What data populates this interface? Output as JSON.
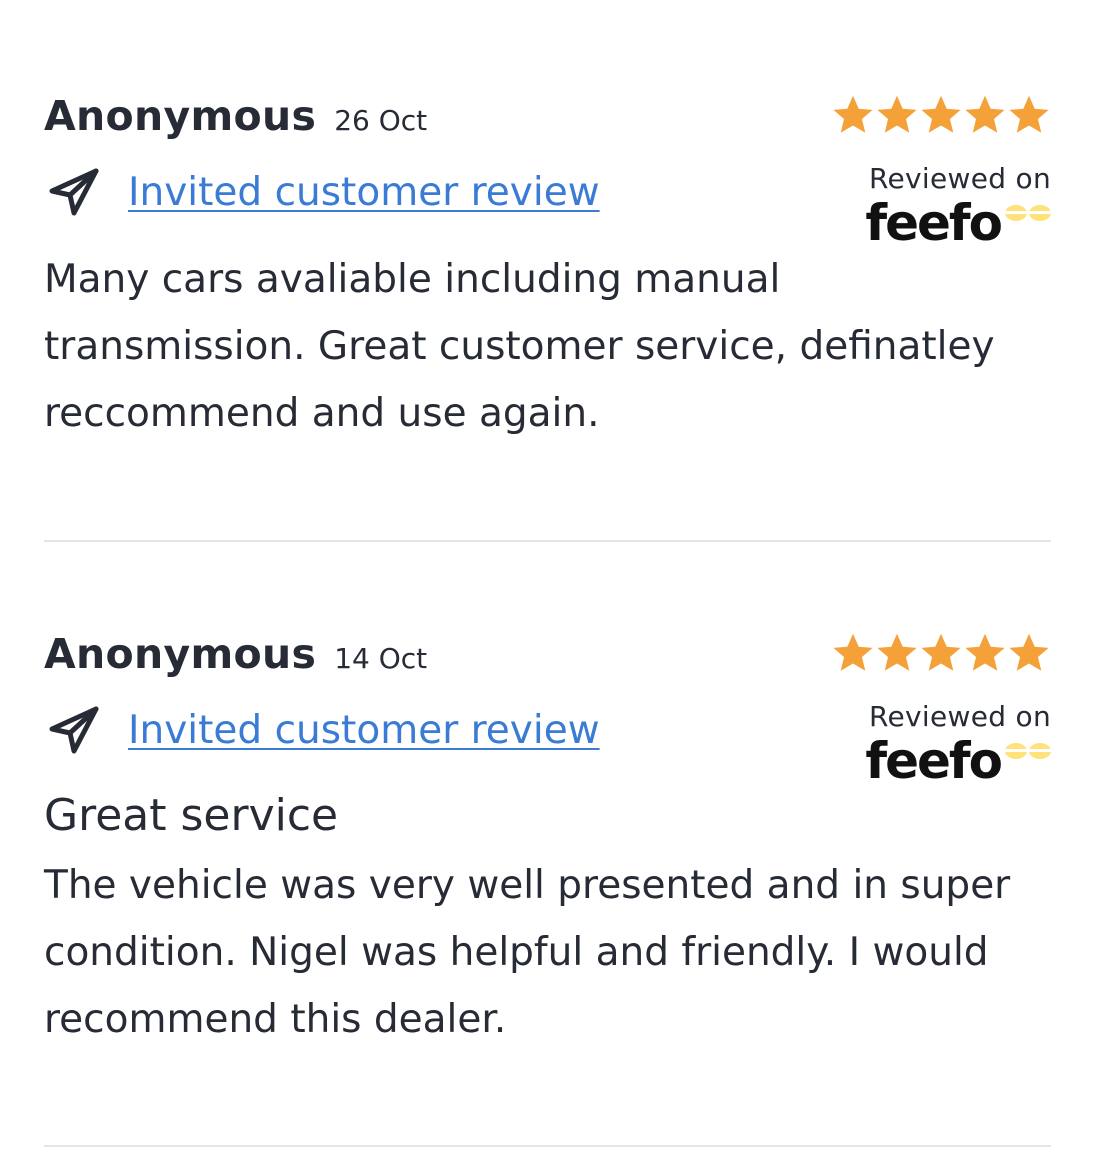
{
  "colors": {
    "text": "#272b36",
    "link": "#3a7bd5",
    "star": "#f5a13a",
    "divider": "#e4e5e7",
    "feefo_eyes": "#ffe27a"
  },
  "reviews": [
    {
      "author": "Anonymous",
      "date": "26 Oct",
      "invite_label": "Invited customer review",
      "invite_icon": "paper-plane-icon",
      "rating": 5,
      "rating_max": 5,
      "reviewed_on": "Reviewed on",
      "platform_logo_text": "feefo",
      "title": "",
      "body": "Many cars avaliable including manual transmission. Great customer service, definatley reccommend and use again."
    },
    {
      "author": "Anonymous",
      "date": "14 Oct",
      "invite_label": "Invited customer review",
      "invite_icon": "paper-plane-icon",
      "rating": 5,
      "rating_max": 5,
      "reviewed_on": "Reviewed on",
      "platform_logo_text": "feefo",
      "title": "Great service",
      "body": "The vehicle was very well presented and in super condition. Nigel was helpful and friendly. I would recommend this dealer."
    }
  ]
}
